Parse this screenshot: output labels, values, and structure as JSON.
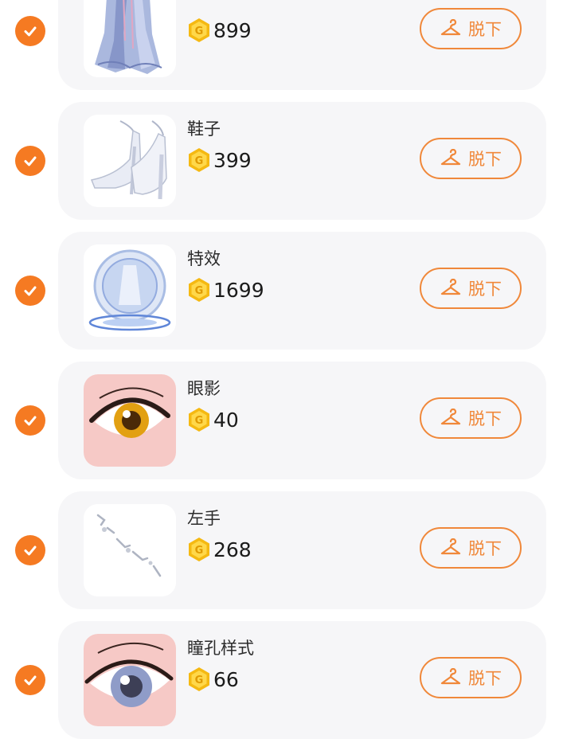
{
  "outfit_list": {
    "items": [
      {
        "name": "",
        "price": "899",
        "action_label": "脱下",
        "selected": true,
        "thumb_icon": "dress-hem-thumbnail-icon"
      },
      {
        "name": "鞋子",
        "price": "399",
        "action_label": "脱下",
        "selected": true,
        "thumb_icon": "crystal-heels-thumbnail-icon"
      },
      {
        "name": "特效",
        "price": "1699",
        "action_label": "脱下",
        "selected": true,
        "thumb_icon": "aura-effect-thumbnail-icon"
      },
      {
        "name": "眼影",
        "price": "40",
        "action_label": "脱下",
        "selected": true,
        "thumb_icon": "golden-eye-thumbnail-icon"
      },
      {
        "name": "左手",
        "price": "268",
        "action_label": "脱下",
        "selected": true,
        "thumb_icon": "left-hand-accessory-thumbnail-icon"
      },
      {
        "name": "瞳孔样式",
        "price": "66",
        "action_label": "脱下",
        "selected": true,
        "thumb_icon": "blue-pupil-thumbnail-icon"
      }
    ]
  },
  "colors": {
    "accent": "#f57a22",
    "card_bg": "#f6f6f8",
    "coin": "#f5b912"
  }
}
